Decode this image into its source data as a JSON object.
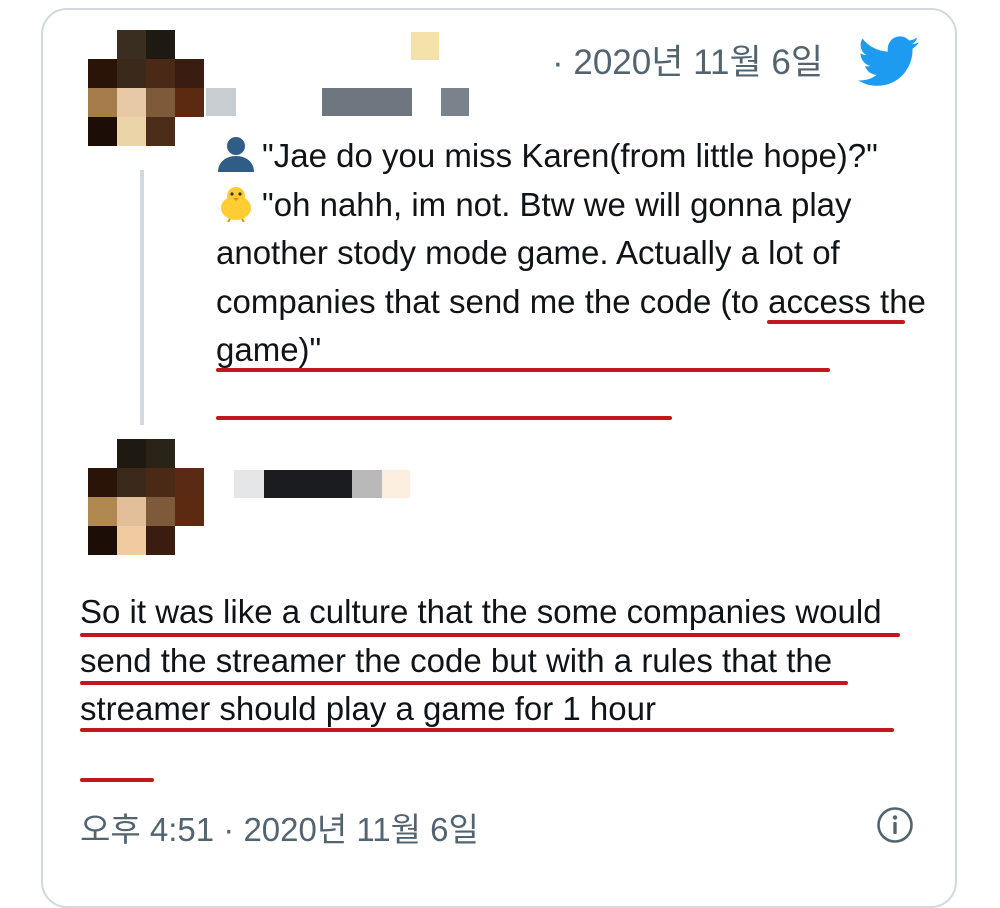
{
  "quoted_tweet": {
    "date": "· 2020년 11월 6일",
    "line1_text": "\"Jae do you miss Karen(from little hope)?\"",
    "line2_text_plain": "\"oh nahh, im not. Btw we will gonna play another stody mode game.",
    "line2_text_highlight": "Actually a lot of companies that send me the code (to access the game)",
    "line2_text_end": "\""
  },
  "main_tweet": {
    "text": "So it was like a culture that the some companies would send the streamer the code but with a rules that the streamer should play a game for 1 hour",
    "timestamp": "오후 4:51 · 2020년 11월 6일"
  },
  "icons": {
    "logo": "twitter-bird-icon",
    "person": "bust-in-silhouette-icon",
    "chick": "baby-chick-icon",
    "info": "info-icon"
  },
  "colors": {
    "twitter_blue": "#1d9bf0",
    "underline_red": "#c0181c",
    "secondary_text": "#536471"
  }
}
